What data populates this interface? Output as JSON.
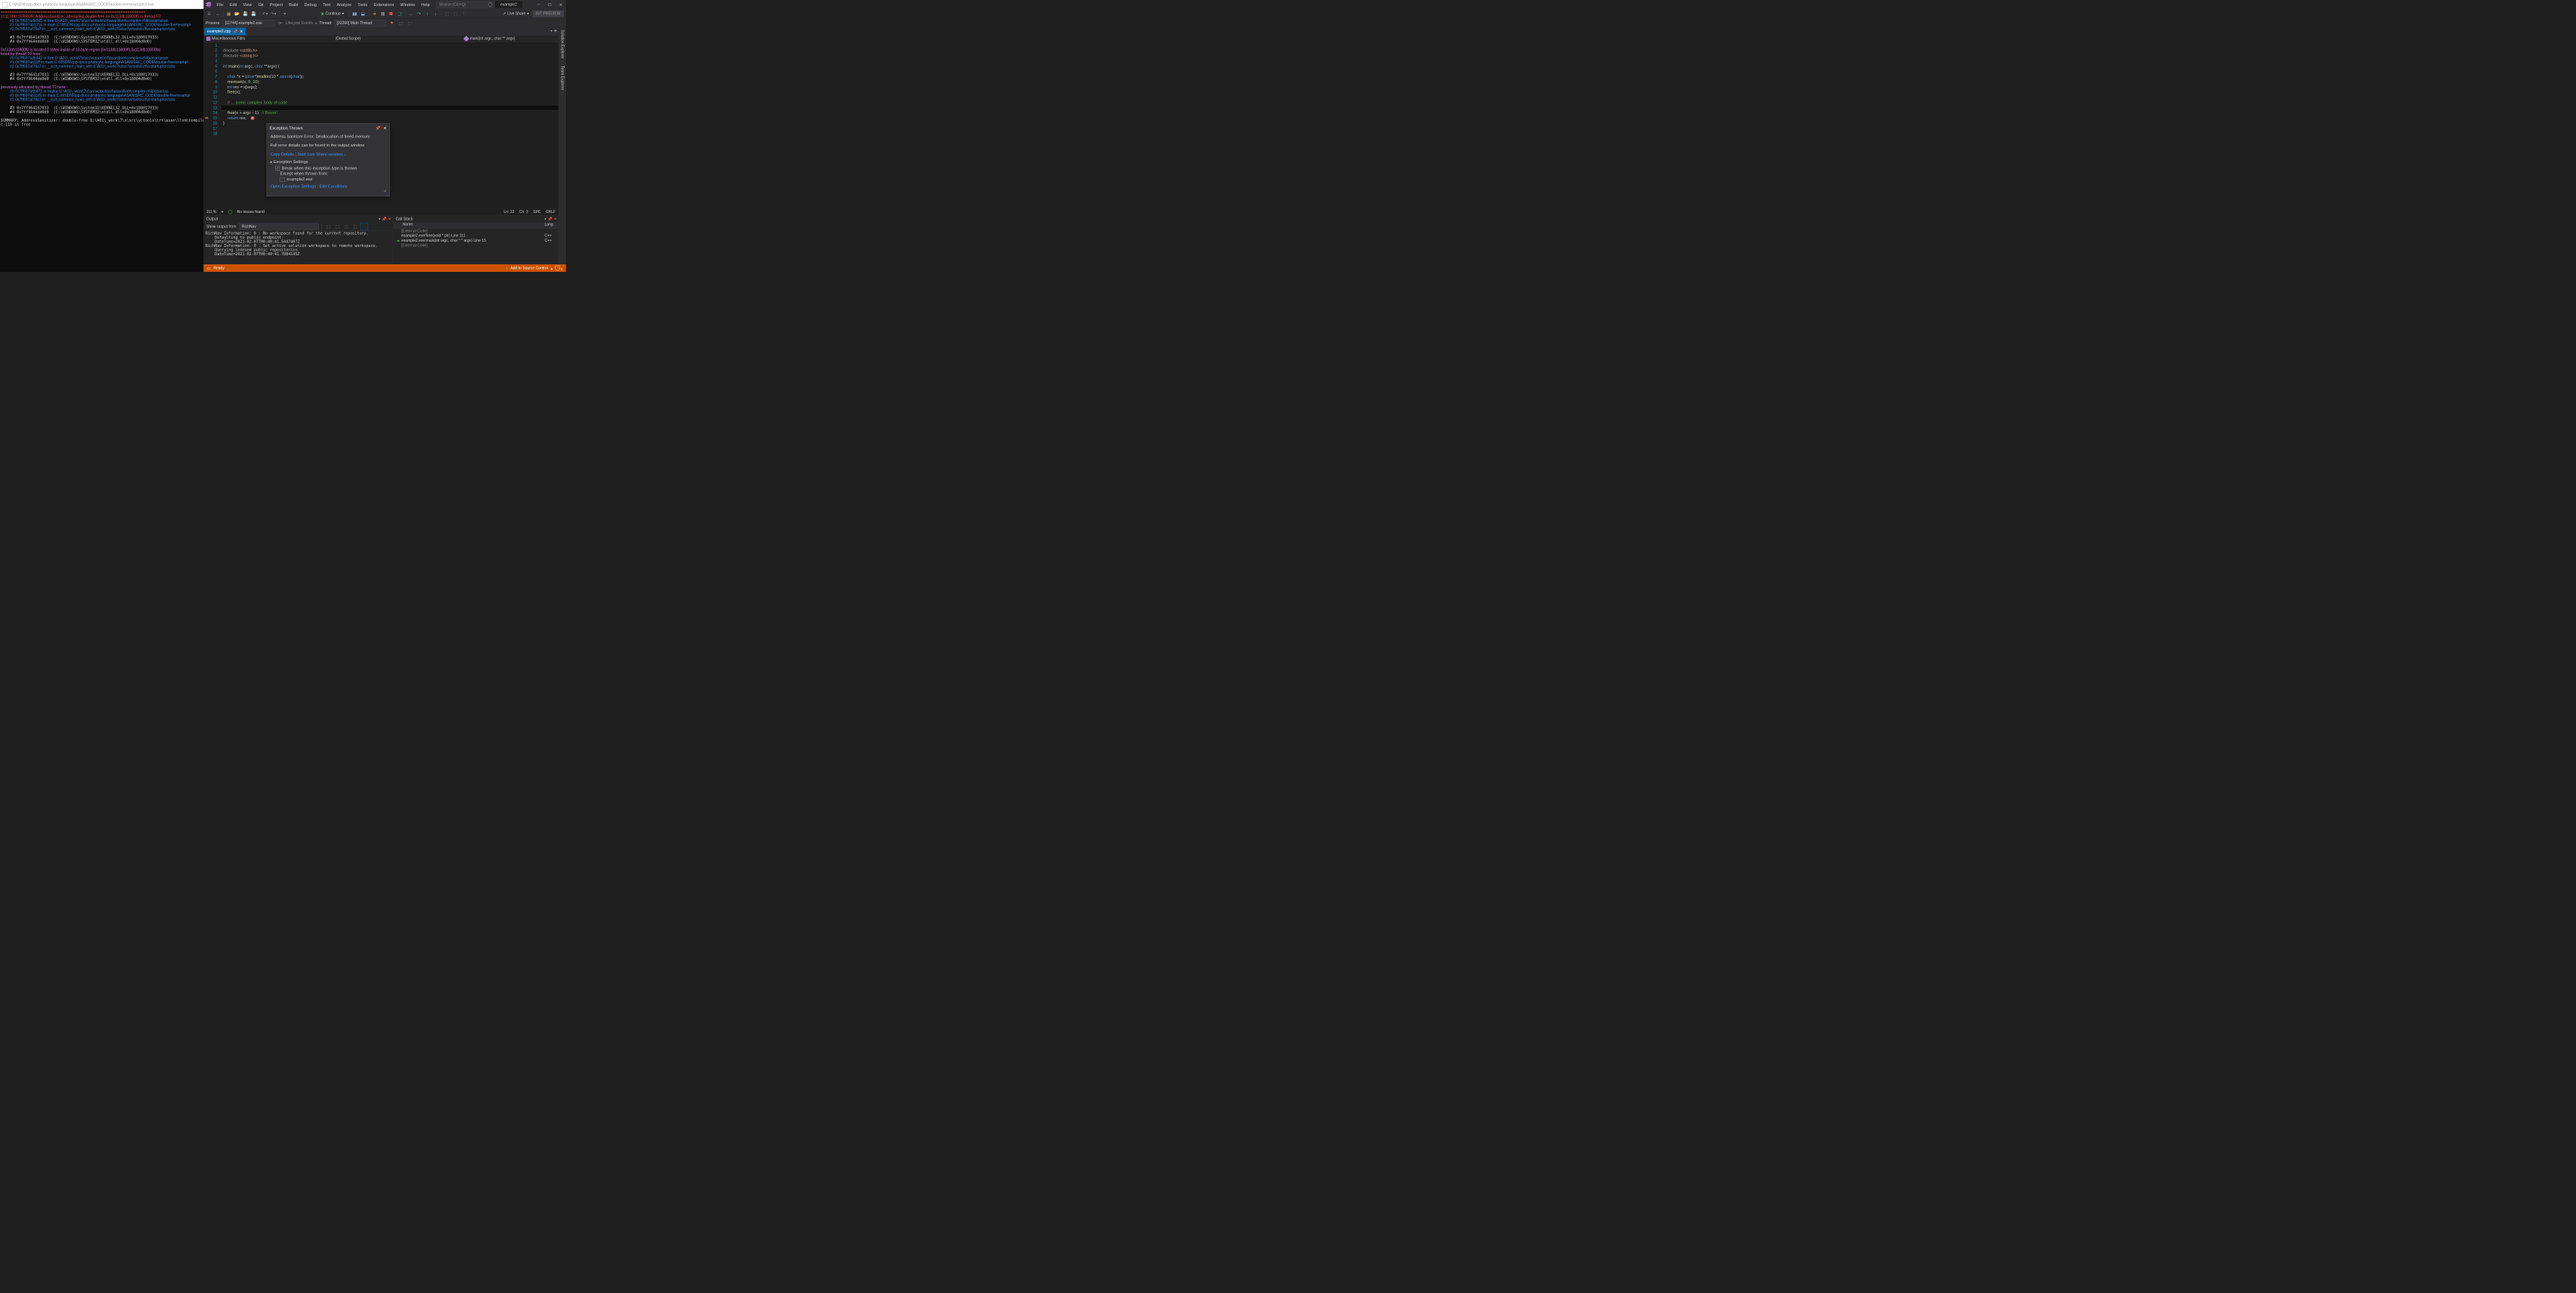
{
  "console": {
    "title": "C:\\MSDN\\cpp-docs-pr\\docs\\c-language\\ASAN\\SRC_CODE\\double-free\\example2.exe",
    "lines_html": "<span class='asan-red'>=================================================================</span>\n<span class='asan-red'>==11744==ERROR: AddressSanitizer: attempting double-free on 0x113db10800f0 in thread T0:</span>\n    <span class='asan-blue'>#0 0x7ff697adb365 in free D:\\A01\\_work\\7\\s\\src\\vctools\\crt\\asan\\llvm\\compiler-rt\\lib\\asan\\asan</span>\n    <span class='asan-blue'>#1 0x7ff697ab1216 in main C:\\MSDN\\cpp-docs-pr\\docs\\c-language\\ASAN\\SRC_CODE\\double-free\\exampl</span>\n    <span class='asan-blue'>#2 0x7ff697af78a7 in __scrt_common_main_seh d:\\A01\\_work\\7\\s\\src\\vctools\\crt\\vcstartup\\src\\sta</span>\n\n    #3 0x7ff9641d7033  (C:\\WINDOWS\\System32\\KERNEL32.DLL+0x180017033)\n    #4 0x7ff9644dd0d0  (C:\\WINDOWS\\SYSTEM32\\ntdll.dll+0x18004d0d0)\n\n<span class='asan-mag'>0x113db10800f0 is located 0 bytes inside of 10-byte region [0x113db10800f0,0x113db10800fa)</span>\n<span class='asan-mag'>freed by thread T0 here:</span>\n    <span class='asan-blue'>#0 0x7ff697adb342 in free D:\\A01\\_work\\7\\s\\src\\vctools\\crt\\asan\\llvm\\compiler-rt\\lib\\asan\\asan</span>\n    <span class='asan-blue'>#1 0x7ff697ab11ff in main C:\\MSDN\\cpp-docs-pr\\docs\\c-language\\ASAN\\SRC_CODE\\double-free\\exampl</span>\n    <span class='asan-blue'>#2 0x7ff697af78a7 in __scrt_common_main_seh d:\\A01\\_work\\7\\s\\src\\vctools\\crt\\vcstartup\\src\\sta</span>\n\n    #3 0x7ff9641d7033  (C:\\WINDOWS\\System32\\KERNEL32.DLL+0x180017033)\n    #4 0x7ff9644dd0d0  (C:\\WINDOWS\\SYSTEM32\\ntdll.dll+0x18004d0d0)\n\n<span class='asan-mag'>previously allocated by thread T0 here:</span>\n    <span class='asan-blue'>#0 0x7ff697adb472 in malloc D:\\A01\\_work\\7\\s\\src\\vctools\\crt\\asan\\llvm\\compiler-rt\\lib\\asan\\as</span>\n    <span class='asan-blue'>#1 0x7ff697ab1182 in main C:\\MSDN\\cpp-docs-pr\\docs\\c-language\\ASAN\\SRC_CODE\\double-free\\exampl</span>\n    <span class='asan-blue'>#2 0x7ff697af78a7 in __scrt_common_main_seh d:\\A01\\_work\\7\\s\\src\\vctools\\crt\\vcstartup\\src\\sta</span>\n\n    #3 0x7ff9641d7033  (C:\\WINDOWS\\System32\\KERNEL32.DLL+0x180017033)\n    #4 0x7ff9644dd0d0  (C:\\WINDOWS\\SYSTEM32\\ntdll.dll+0x18004d0d0)\n\nSUMMARY: AddressSanitizer: double-free D:\\A01\\_work\\7\\s\\src\\vctools\\crt\\asan\\llvm\\compiler-rt\\lib\\\nc:110 in free"
  },
  "vs": {
    "menu": [
      "File",
      "Edit",
      "View",
      "Git",
      "Project",
      "Build",
      "Debug",
      "Test",
      "Analyze",
      "Tools",
      "Extensions",
      "Window",
      "Help"
    ],
    "search_placeholder": "Search (Ctrl+Q)",
    "solution_name": "example2",
    "toolbar": {
      "continue_label": "Continue",
      "liveshare_label": "Live Share",
      "int_preview": "INT PREVIEW"
    },
    "debugbar": {
      "process_label": "Process:",
      "process_value": "[11744] example2.exe",
      "lifecycle_label": "Lifecycle Events",
      "thread_label": "Thread:",
      "thread_value": "[32260] Main Thread"
    },
    "tab_name": "example2.cpp",
    "navbar": {
      "scope1": "Miscellaneous Files",
      "scope2": "(Global Scope)",
      "scope3": "main(int argc, char ** argv)"
    },
    "code_lines": [
      "",
      "<span class='pp'>#include</span> <span class='str'>&lt;stdlib.h&gt;</span>",
      "<span class='pp'>#include</span> <span class='str'>&lt;string.h&gt;</span>",
      "",
      "<span class='kw'>int</span> <span class='fn'>main</span>(<span class='kw'>int</span> argc, <span class='kw'>char</span> **argv) {",
      "",
      "    <span class='kw'>char</span> *x = (<span class='kw'>char</span>*)<span class='fn'>malloc</span>(<span class='num'>10</span> * <span class='kw'>sizeof</span>(<span class='kw'>char</span>));",
      "    <span class='fn'>memset</span>(x, <span class='num'>0</span>, <span class='num'>10</span>);",
      "    <span class='kw'>int</span> res = x[argc];",
      "    <span class='fn'>free</span>(x);",
      "",
      "    <span class='cm'>// ... some complex body of code</span>",
      "",
      "    <span class='fn'>free</span>(x + argc - <span class='num'>1</span>);  <span class='cm'>// Boom!</span>",
      "    <span class='kw'>return</span> res;",
      "}",
      "",
      ""
    ],
    "editor_status": {
      "zoom": "111 %",
      "issues": "No issues found",
      "line": "Ln: 13",
      "col": "Ch: 3",
      "spc": "SPC",
      "crlf": "CRLF"
    },
    "popup": {
      "title": "Exception Thrown",
      "message": "Address Sanitizer Error: Deallocation of freed memory",
      "detail": "Full error details can be found in the output window",
      "copy": "Copy Details",
      "liveshare": "Start Live Share session...",
      "settings_header": "Exception Settings",
      "break_when": "Break when this exception type is thrown",
      "except_when": "Except when thrown from:",
      "module": "example2.exe",
      "open_settings": "Open Exception Settings",
      "edit_cond": "Edit Conditions"
    },
    "output": {
      "title": "Output",
      "show_from_label": "Show output from:",
      "show_from_value": "RichNav",
      "body": "RichNav Information: 0 : No workspace found for the current repository.\n    Defaulting to public endpoint.\n    DateTime=2021-02-07T00:40:41.5447407Z\nRichNav Information: 0 : Set active solution workspace to remote workspace.\n    Querying indexed public repositories.\n    DateTime=2021-02-07T00:40:41.7884145Z"
    },
    "callstack": {
      "title": "Call Stack",
      "col_name": "Name",
      "col_lang": "Lang",
      "rows": [
        {
          "name": "[External Code]",
          "lang": "",
          "dim": true,
          "icon": ""
        },
        {
          "name": "example2.exe!free(void * ptr) Line 111",
          "lang": "C++",
          "dim": false,
          "icon": ""
        },
        {
          "name": "example2.exe!main(int argc, char * * argv) Line 15",
          "lang": "C++",
          "dim": false,
          "icon": "➡"
        },
        {
          "name": "[External Code]",
          "lang": "",
          "dim": true,
          "icon": ""
        }
      ]
    },
    "rail": [
      "Solution Explorer",
      "Team Explorer"
    ],
    "status": {
      "ready": "Ready",
      "source_control": "Add to Source Control",
      "bell_count": "2"
    }
  }
}
